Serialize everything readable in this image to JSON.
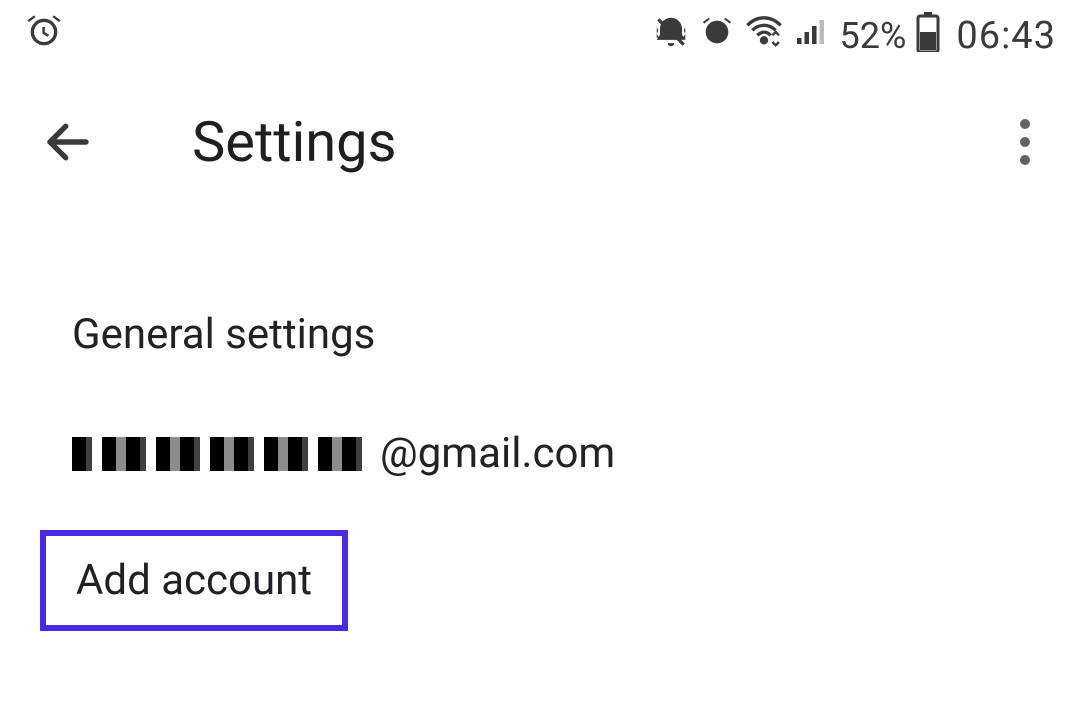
{
  "status": {
    "battery_pct": "52%",
    "time": "06:43"
  },
  "header": {
    "title": "Settings"
  },
  "list": {
    "general": "General settings",
    "account_suffix": "@gmail.com",
    "add_account": "Add account"
  }
}
